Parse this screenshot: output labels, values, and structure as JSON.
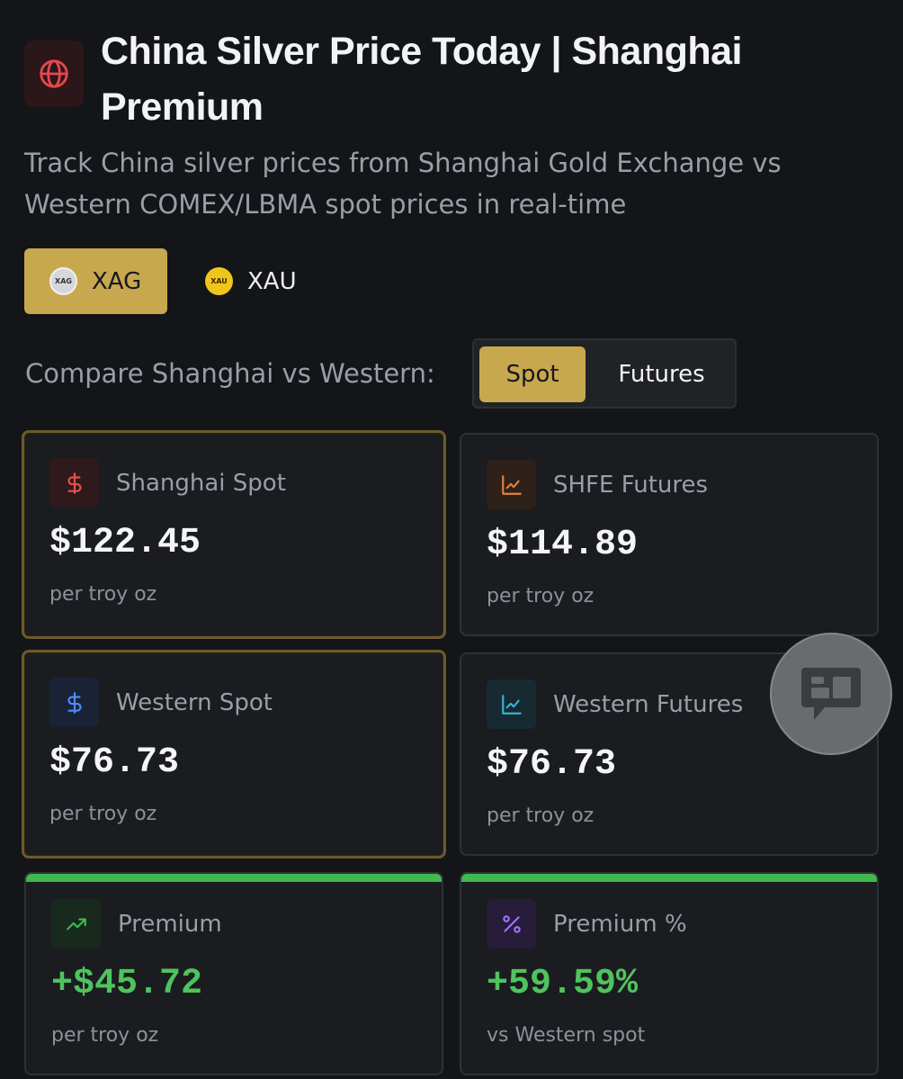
{
  "header": {
    "title": "China Silver Price Today | Shanghai Premium",
    "subtitle": "Track China silver prices from Shanghai Gold Exchange vs Western COMEX/LBMA spot prices in real-time",
    "icon": "globe-icon"
  },
  "metals": [
    {
      "label": "XAG",
      "coin": "XAG",
      "selected": true
    },
    {
      "label": "XAU",
      "coin": "XAU",
      "selected": false
    }
  ],
  "compare": {
    "label": "Compare Shanghai vs Western:",
    "options": [
      {
        "label": "Spot",
        "selected": true
      },
      {
        "label": "Futures",
        "selected": false
      }
    ]
  },
  "cards": [
    {
      "label": "Shanghai Spot",
      "value": "$122.45",
      "unit": "per troy oz",
      "icon": "dollar-icon",
      "icon_color": "#e5534b"
    },
    {
      "label": "SHFE Futures",
      "value": "$114.89",
      "unit": "per troy oz",
      "icon": "line-chart-icon",
      "icon_color": "#e0823d"
    },
    {
      "label": "Western Spot",
      "value": "$76.73",
      "unit": "per troy oz",
      "icon": "dollar-icon",
      "icon_color": "#4c8dff"
    },
    {
      "label": "Western Futures",
      "value": "$76.73",
      "unit": "per troy oz",
      "icon": "line-chart-icon",
      "icon_color": "#39b1d4"
    },
    {
      "label": "Premium",
      "value": "+$45.72",
      "unit": "per troy oz",
      "icon": "trending-up-icon",
      "icon_color": "#3fb950"
    },
    {
      "label": "Premium %",
      "value": "+59.59%",
      "unit": "vs Western spot",
      "icon": "percent-icon",
      "icon_color": "#a371f7"
    }
  ],
  "colors": {
    "accent": "#c8a84e",
    "positive": "#3fb950",
    "background": "#141518"
  }
}
